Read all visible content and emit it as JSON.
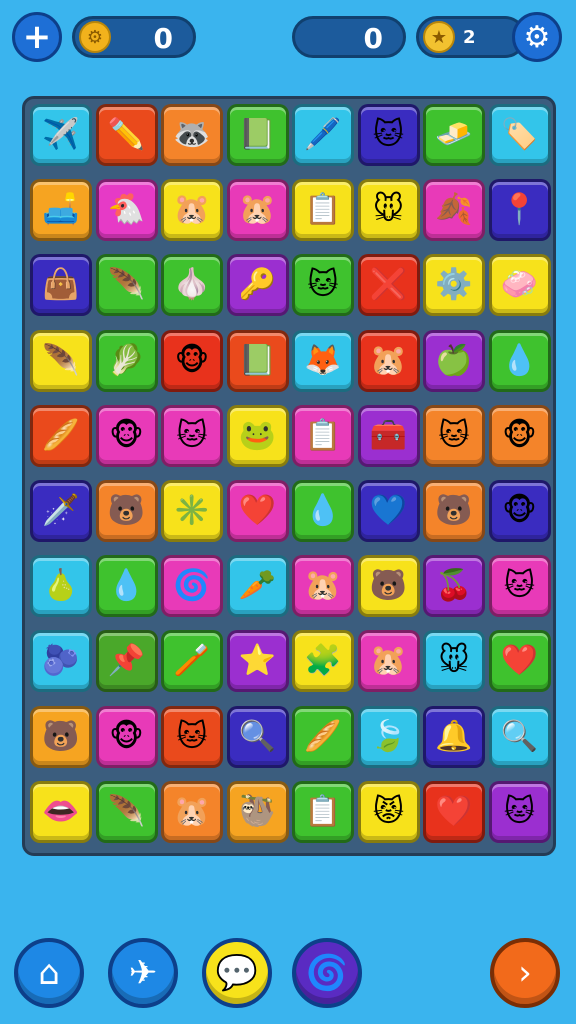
{
  "hud": {
    "add_icon": "plus-icon",
    "left_counter": "0",
    "left_counter_icon": "gear-coin-icon",
    "middle_counter": "0",
    "right_counter_icon": "gold-coin-icon",
    "right_counter": "2",
    "settings_icon": "gear-icon"
  },
  "board": {
    "rows": [
      [
        {
          "c": "#33c5ea",
          "g": "✈️"
        },
        {
          "c": "#ea4a1c",
          "g": "✏️"
        },
        {
          "c": "#f4842a",
          "g": "🦝"
        },
        {
          "c": "#3fc22e",
          "g": "📗"
        },
        {
          "c": "#33c5ea",
          "g": "🖊️"
        },
        {
          "c": "#3a2cc0",
          "g": "🐱"
        },
        {
          "c": "#3fc22e",
          "g": "🧈"
        },
        {
          "c": "#33c5ea",
          "g": "🏷️"
        }
      ],
      [
        {
          "c": "#f6a421",
          "g": "🛋️"
        },
        {
          "c": "#e63ac6",
          "g": "🐔"
        },
        {
          "c": "#f7e21b",
          "g": "🐹"
        },
        {
          "c": "#e83ab8",
          "g": "🐹"
        },
        {
          "c": "#f7e21b",
          "g": "📋"
        },
        {
          "c": "#f7e21b",
          "g": "🐭"
        },
        {
          "c": "#e83ab8",
          "g": "🍂"
        },
        {
          "c": "#3a2cc0",
          "g": "📍"
        }
      ],
      [
        {
          "c": "#3a2cc0",
          "g": "👜"
        },
        {
          "c": "#3fc22e",
          "g": "🪶"
        },
        {
          "c": "#3fc22e",
          "g": "🧄"
        },
        {
          "c": "#9b2fd0",
          "g": "🔑"
        },
        {
          "c": "#3fc22e",
          "g": "🐱"
        },
        {
          "c": "#e8321c",
          "g": "❌"
        },
        {
          "c": "#f7e21b",
          "g": "⚙️"
        },
        {
          "c": "#f7e21b",
          "g": "🧼"
        }
      ],
      [
        {
          "c": "#f7e21b",
          "g": "🪶"
        },
        {
          "c": "#3fc22e",
          "g": "🥬"
        },
        {
          "c": "#e8321c",
          "g": "🐵"
        },
        {
          "c": "#ea4a1c",
          "g": "📗"
        },
        {
          "c": "#33c5ea",
          "g": "🦊"
        },
        {
          "c": "#e8321c",
          "g": "🐹"
        },
        {
          "c": "#9b2fd0",
          "g": "🍏"
        },
        {
          "c": "#3fc22e",
          "g": "💧"
        }
      ],
      [
        {
          "c": "#ea4a1c",
          "g": "🥖"
        },
        {
          "c": "#e83ab8",
          "g": "🐵"
        },
        {
          "c": "#e83ab8",
          "g": "🐱"
        },
        {
          "c": "#f7e21b",
          "g": "🐸"
        },
        {
          "c": "#e83ab8",
          "g": "📋"
        },
        {
          "c": "#9b2fd0",
          "g": "🧰"
        },
        {
          "c": "#f4842a",
          "g": "🐱"
        },
        {
          "c": "#f4842a",
          "g": "🐵"
        }
      ],
      [
        {
          "c": "#3a2cc0",
          "g": "🗡️"
        },
        {
          "c": "#f4842a",
          "g": "🐻"
        },
        {
          "c": "#f7e21b",
          "g": "✳️"
        },
        {
          "c": "#e83ab8",
          "g": "❤️"
        },
        {
          "c": "#3fc22e",
          "g": "💧"
        },
        {
          "c": "#3a2cc0",
          "g": "💙"
        },
        {
          "c": "#f4842a",
          "g": "🐻"
        },
        {
          "c": "#3a2cc0",
          "g": "🐵"
        }
      ],
      [
        {
          "c": "#33c5ea",
          "g": "🍐"
        },
        {
          "c": "#3fc22e",
          "g": "💧"
        },
        {
          "c": "#e83ab8",
          "g": "🌀"
        },
        {
          "c": "#33c5ea",
          "g": "🥕"
        },
        {
          "c": "#e83ab8",
          "g": "🐹"
        },
        {
          "c": "#f7e21b",
          "g": "🐻"
        },
        {
          "c": "#9b2fd0",
          "g": "🍒"
        },
        {
          "c": "#e83ab8",
          "g": "🐱"
        }
      ],
      [
        {
          "c": "#33c5ea",
          "g": "🫐"
        },
        {
          "c": "#4aa82a",
          "g": "📌"
        },
        {
          "c": "#3fc22e",
          "g": "🪥"
        },
        {
          "c": "#9b2fd0",
          "g": "⭐"
        },
        {
          "c": "#f7e21b",
          "g": "🧩"
        },
        {
          "c": "#e83ab8",
          "g": "🐹"
        },
        {
          "c": "#33c5ea",
          "g": "🐭"
        },
        {
          "c": "#3fc22e",
          "g": "❤️"
        }
      ],
      [
        {
          "c": "#f6a421",
          "g": "🐻"
        },
        {
          "c": "#e83ab8",
          "g": "🐵"
        },
        {
          "c": "#ea4a1c",
          "g": "🐱"
        },
        {
          "c": "#3a2cc0",
          "g": "🔍"
        },
        {
          "c": "#3fc22e",
          "g": "🥖"
        },
        {
          "c": "#33c5ea",
          "g": "🍃"
        },
        {
          "c": "#3a2cc0",
          "g": "🔔"
        },
        {
          "c": "#33c5ea",
          "g": "🔍"
        }
      ],
      [
        {
          "c": "#f7e21b",
          "g": "👄"
        },
        {
          "c": "#3fc22e",
          "g": "🪶"
        },
        {
          "c": "#f4842a",
          "g": "🐹"
        },
        {
          "c": "#f6a421",
          "g": "🦥"
        },
        {
          "c": "#3fc22e",
          "g": "📋"
        },
        {
          "c": "#f7e21b",
          "g": "😾"
        },
        {
          "c": "#e8321c",
          "g": "❤️"
        },
        {
          "c": "#9b2fd0",
          "g": "🐱"
        }
      ]
    ]
  },
  "bottom": {
    "home_icon": "home-icon",
    "plane_icon": "paper-plane-icon",
    "chat_icon": "chat-bubble-icon",
    "swirl_icon": "swirl-icon",
    "next_icon": "next-arrow-icon"
  }
}
